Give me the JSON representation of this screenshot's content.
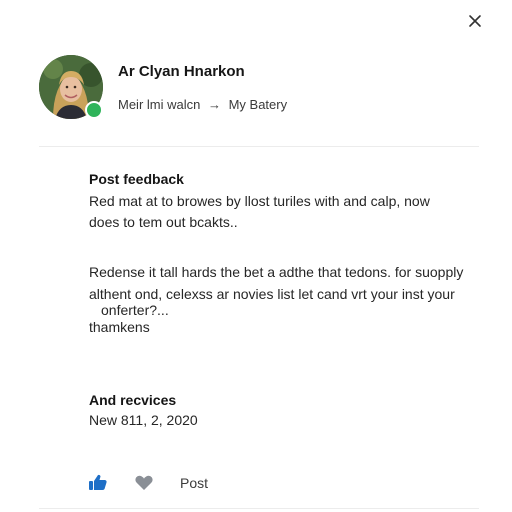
{
  "header": {
    "user_name": "Ar Clyan Hnarkon",
    "breadcrumb_from": "Meir lmi walcn",
    "breadcrumb_arrow": "→",
    "breadcrumb_to": "My Batery"
  },
  "feedback": {
    "title": "Post feedback",
    "line1": "Red mat at to browes by llost turiles with and calp, now",
    "line2": "does to tem out bcakts..",
    "para2_line1": "Redense it tall hards the bet a adthe that tedons. for suopply",
    "para2_line2": "althent ond, celexss ar novies list let cand vrt your inst your",
    "para2_line3": "onferter?...",
    "para2_line4": "thamkens"
  },
  "revisions": {
    "title": "And recvices",
    "date": "New 811, 2, 2020"
  },
  "actions": {
    "post_label": "Post"
  },
  "icons": {
    "close": "close-icon",
    "like": "thumbs-up-icon",
    "favorite": "heart-icon"
  },
  "colors": {
    "status": "#2fb45a",
    "like": "#1e6fc7",
    "heart": "#8a8f96"
  }
}
